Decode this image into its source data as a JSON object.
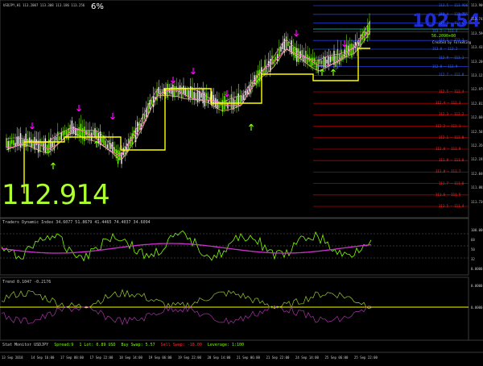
{
  "header": {
    "symbol_info": "USDJPY,H1  113.2007 113.308 113.186 113.256",
    "percent": "6%"
  },
  "big_price": "112.914",
  "corner": {
    "big_value": "102.54",
    "sub_value": "56.2090+00",
    "small_text": "Created by ForexKing"
  },
  "levels_top": [
    "113.5 — 113.906",
    "113.4 — 113.755",
    "113.3 — 113.6",
    "113.2 — 113.4",
    "113.1 — 113.3",
    "113.0 — 113.2",
    "112.9 — 113.1",
    "112.8 — 112.9",
    "112.7 — 112.8"
  ],
  "levels_bottom": [
    "112.5 — 112.4",
    "112.4 — 112.3",
    "112.3 — 112.2",
    "112.2 — 112.1",
    "112.1 — 112.0",
    "112.0 — 111.9",
    "111.9 — 111.8",
    "111.8 — 111.7",
    "111.7 — 111.6",
    "111.6 — 111.5",
    "111.5 — 111.4"
  ],
  "price_axis": [
    "113.900",
    "113.745",
    "113.590",
    "113.435",
    "113.280",
    "113.125",
    "112.970",
    "112.815",
    "112.660",
    "112.505",
    "112.350",
    "112.195",
    "112.040",
    "111.885",
    "111.730"
  ],
  "indicator1": {
    "label": "Traders Dynamic Index 34.6077 51.8679 41.4465 74.4037 34.6094",
    "axis": [
      "100.0000",
      "68",
      "50",
      "32",
      "0.0000"
    ]
  },
  "indicator2": {
    "label": "Trend 0.1047 -0.2176",
    "axis": [
      "0.0000",
      "0.0000"
    ]
  },
  "status": {
    "spread_label": "Stat Monitor USDJPY",
    "spread": "Spread:9",
    "lot": "1 Lot: 0.89 USD",
    "buy_swap": "Buy Swap: 5.57",
    "sell_swap": "Sell Swap: -18.00",
    "leverage": "Leverage: 1:100"
  },
  "time_axis": [
    "13 Sep 2018",
    "14 Sep 16:00",
    "17 Sep 08:00",
    "17 Sep 22:00",
    "18 Sep 14:00",
    "19 Sep 06:00",
    "19 Sep 22:00",
    "20 Sep 14:00",
    "21 Sep 06:00",
    "21 Sep 22:00",
    "24 Sep 14:00",
    "25 Sep 06:00",
    "25 Sep 22:00"
  ],
  "colors": {
    "bull": "#7fff00",
    "bear": "#ffffff",
    "signal_arrow_down": "#ff00ff",
    "signal_arrow_up": "#7fff00",
    "yellow_line": "#ffff00",
    "ma_pink": "#ff66cc",
    "ma_wheat": "#deb887",
    "level_top": "#1f3bd6",
    "level_bottom": "#b00000",
    "level_text_top": "#3b6bff",
    "level_text_bottom": "#ff3030"
  }
}
